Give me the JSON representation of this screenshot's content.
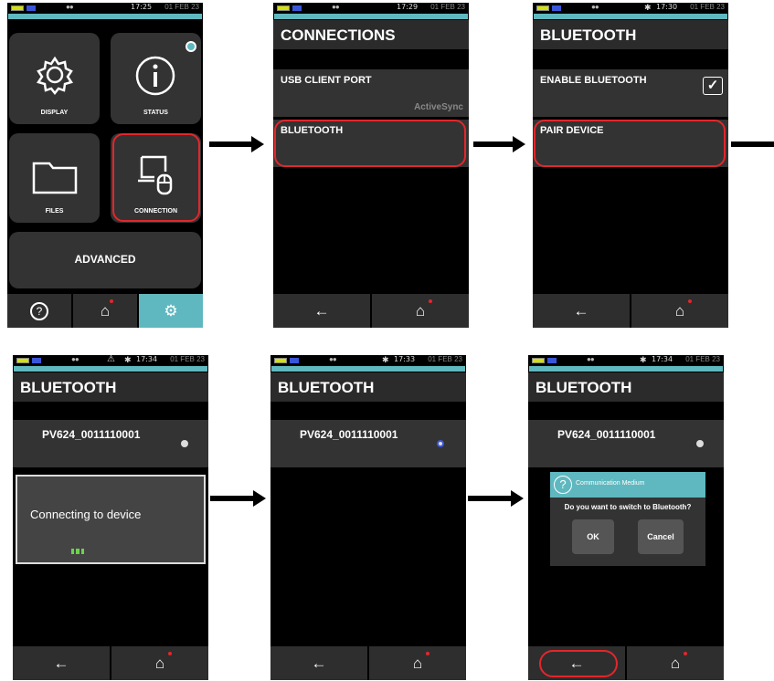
{
  "status": {
    "eyes": "●●",
    "date": "01 FEB 23",
    "bt": "✱",
    "warn": "⚠"
  },
  "s1": {
    "time": "17:25",
    "tiles": [
      "DISPLAY",
      "STATUS",
      "FILES",
      "CONNECTION"
    ],
    "advanced": "ADVANCED"
  },
  "s2": {
    "time": "17:29",
    "title": "CONNECTIONS",
    "usb": "USB CLIENT PORT",
    "usb_sub": "ActiveSync",
    "bluetooth": "BLUETOOTH"
  },
  "s3": {
    "time": "17:30",
    "title": "BLUETOOTH",
    "enable": "ENABLE BLUETOOTH",
    "pair": "PAIR DEVICE"
  },
  "s4": {
    "time": "17:34",
    "title": "BLUETOOTH",
    "device": "PV624_0011110001",
    "connecting": "Connecting to device"
  },
  "s5": {
    "time": "17:33",
    "title": "BLUETOOTH",
    "device": "PV624_0011110001"
  },
  "s6": {
    "time": "17:34",
    "title": "BLUETOOTH",
    "device": "PV624_0011110001",
    "dlg_title": "Communication Medium",
    "dlg_msg": "Do you want to switch to Bluetooth?",
    "ok": "OK",
    "cancel": "Cancel"
  },
  "nav": {
    "help": "?",
    "home": "⌂",
    "settings": "⚙",
    "back": "←"
  },
  "colors": {
    "accent": "#5fb8bf",
    "highlight": "#e3262b",
    "progress": "#6bd44a"
  }
}
